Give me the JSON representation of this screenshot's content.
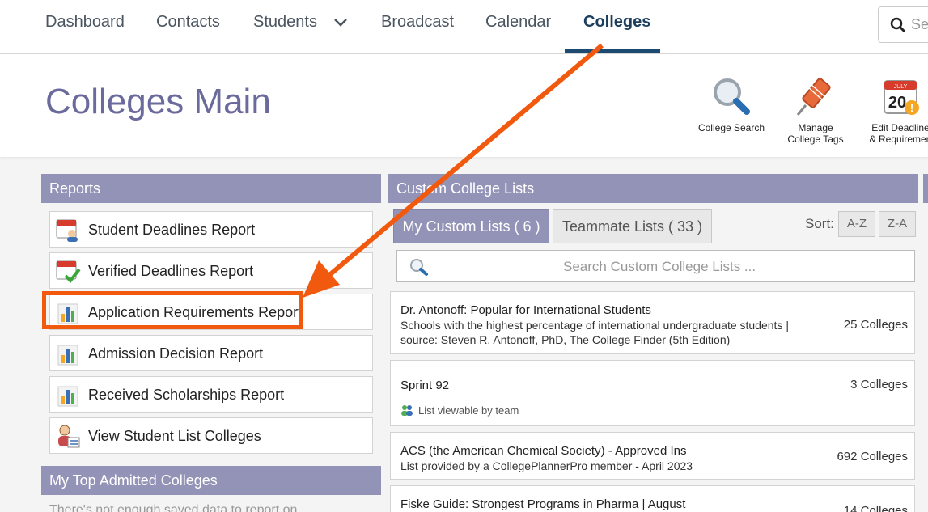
{
  "nav": {
    "items": [
      "Dashboard",
      "Contacts",
      "Students",
      "Broadcast",
      "Calendar",
      "Colleges"
    ],
    "active": "Colleges",
    "search_placeholder": "Sea"
  },
  "header": {
    "title": "Colleges Main",
    "tools": [
      {
        "label_line1": "College Search",
        "label_line2": "",
        "icon": "magnifier-icon"
      },
      {
        "label_line1": "Manage",
        "label_line2": "College Tags",
        "icon": "tag-icon"
      },
      {
        "label_line1": "Edit Deadline",
        "label_line2": "& Requiremen",
        "icon": "calendar-deadline-icon",
        "calendar_month": "JULY",
        "calendar_day": "20"
      }
    ]
  },
  "reports": {
    "heading": "Reports",
    "items": [
      {
        "label": "Student Deadlines Report",
        "icon": "calendar-student-icon"
      },
      {
        "label": "Verified Deadlines Report",
        "icon": "calendar-check-icon"
      },
      {
        "label": "Application Requirements Report",
        "icon": "bar-chart-icon"
      },
      {
        "label": "Admission Decision Report",
        "icon": "bar-chart-icon"
      },
      {
        "label": "Received Scholarships Report",
        "icon": "bar-chart-icon"
      },
      {
        "label": "View Student List Colleges",
        "icon": "student-list-icon"
      }
    ],
    "highlighted_index": 2
  },
  "top_admitted": {
    "heading": "My Top Admitted Colleges",
    "message": "There's not enough saved data to report on"
  },
  "custom_lists": {
    "heading": "Custom College Lists",
    "tabs": [
      "My Custom Lists ( 6 )",
      "Teammate Lists ( 33 )"
    ],
    "active_tab": 0,
    "sort_label": "Sort:",
    "sort_options": [
      "A-Z",
      "Z-A"
    ],
    "search_placeholder": "Search Custom College Lists ...",
    "lists": [
      {
        "title": "Dr. Antonoff: Popular for International Students",
        "description": "Schools with the highest percentage of international undergraduate students | source: Steven R. Antonoff, PhD, The College Finder (5th Edition)",
        "count": "25 Colleges",
        "team": ""
      },
      {
        "title": "Sprint 92",
        "description": "",
        "count": "3 Colleges",
        "team": "List viewable by team"
      },
      {
        "title": "ACS (the American Chemical Society) - Approved Ins",
        "description": "List provided by a CollegePlannerPro member - April 2023",
        "count": "692 Colleges",
        "team": ""
      },
      {
        "title": "Fiske Guide: Strongest Programs in Pharma | August",
        "description": "",
        "count": "14 Colleges",
        "team": ""
      }
    ]
  },
  "colors": {
    "panel_header": "#9393b7",
    "title": "#6b6a9c",
    "annotation": "#f15a0e",
    "nav_active": "#1c4a70"
  }
}
